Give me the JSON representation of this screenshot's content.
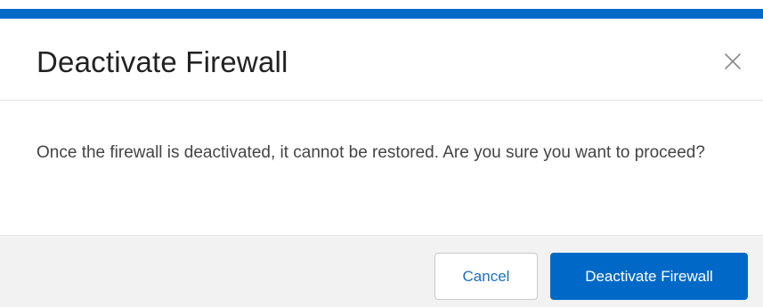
{
  "dialog": {
    "title": "Deactivate Firewall",
    "message": "Once the firewall is deactivated, it cannot be restored. Are you sure you want to proceed?",
    "close_icon": "close-icon",
    "cancel_label": "Cancel",
    "confirm_label": "Deactivate Firewall"
  },
  "colors": {
    "accent": "#0069c8",
    "footer_bg": "#f2f2f2",
    "title_text": "#222222",
    "body_text": "#444444"
  }
}
